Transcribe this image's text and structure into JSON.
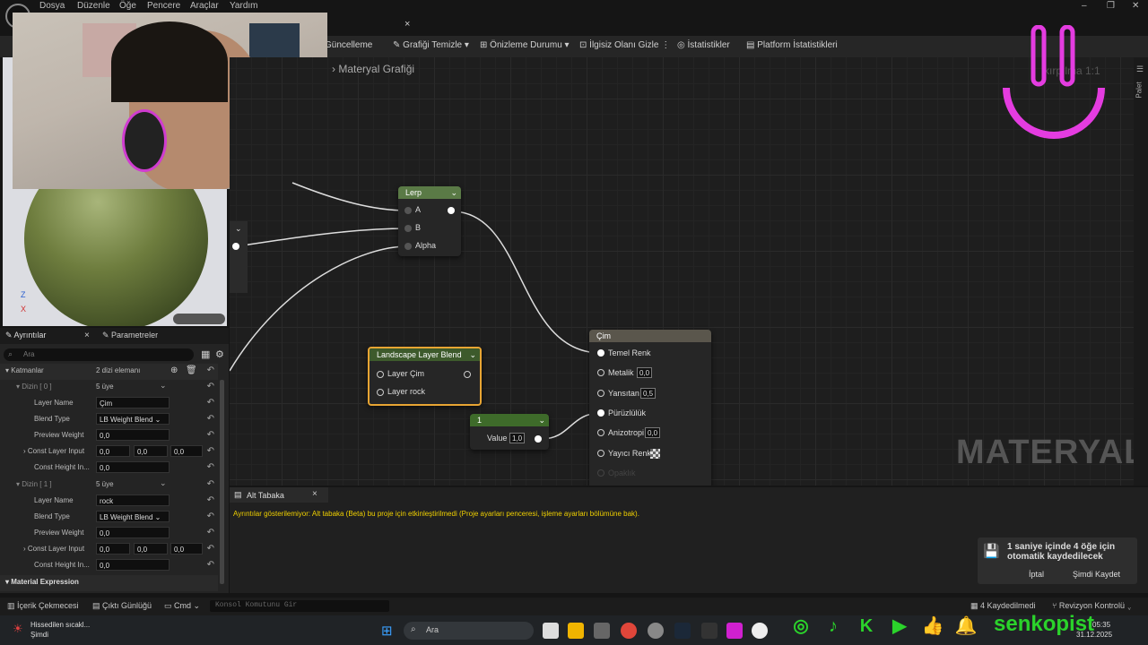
{
  "menu": {
    "items": [
      "Dosya",
      "Düzenle",
      "Öğe",
      "Pencere",
      "Araçlar",
      "Yardım"
    ]
  },
  "window_controls": {
    "minimize": "–",
    "maximize": "❐",
    "close": "✕"
  },
  "toolbar": {
    "update_label": "Güncelleme",
    "clean_graph_label": "Grafiği Temizle",
    "preview_state_label": "Önizleme Durumu",
    "hide_unrelated_label": "İlgisiz Olanı Gizle",
    "stats_label": "İstatistikler",
    "platform_stats_label": "Platform İstatistikleri",
    "tab_close": "×"
  },
  "graph": {
    "breadcrumb_label": "Materyal Grafiği",
    "breadcrumb_chevron": "›",
    "side_tab_label": "Palet",
    "partial_text": "kırpılma 1:1",
    "watermark": "MATERYAL",
    "nodes": {
      "lerp": {
        "title": "Lerp",
        "pins": [
          "A",
          "B",
          "Alpha"
        ]
      },
      "landscape": {
        "title": "Landscape Layer Blend",
        "pins": [
          "Layer Çim",
          "Layer rock"
        ]
      },
      "constant": {
        "title": "1",
        "value_label": "Value",
        "value": "1,0"
      },
      "material": {
        "title": "Çim",
        "pins": [
          {
            "label": "Temel Renk",
            "value": ""
          },
          {
            "label": "Metalik",
            "value": "0,0"
          },
          {
            "label": "Yansıtan",
            "value": "0,5"
          },
          {
            "label": "Pürüzlülük",
            "value": ""
          },
          {
            "label": "Anizotropi",
            "value": "0,0"
          },
          {
            "label": "Yayıcı Renk",
            "value": ""
          },
          {
            "label": "Opaklık",
            "value": ""
          }
        ]
      }
    }
  },
  "details_panel": {
    "tab_details": "Ayrıntılar",
    "tab_params": "Parametreler",
    "close": "×",
    "search_placeholder": "Ara",
    "layers_label": "Katmanlar",
    "layers_count": "2 dizi elemanı",
    "groups": [
      {
        "index_label": "Dizin [ 0 ]",
        "count": "5 üye",
        "layer_name": "Çim",
        "blend_type": "LB Weight Blend",
        "preview_weight": "0,0",
        "const_layer_input": [
          "0,0",
          "0,0",
          "0,0"
        ],
        "const_height_input": "0,0"
      },
      {
        "index_label": "Dizin [ 1 ]",
        "count": "5 üye",
        "layer_name": "rock",
        "blend_type": "LB Weight Blend",
        "preview_weight": "0,0",
        "const_layer_input": [
          "0,0",
          "0,0",
          "0,0"
        ],
        "const_height_input": "0,0"
      }
    ],
    "field_labels": {
      "layer_name": "Layer Name",
      "blend_type": "Blend Type",
      "preview_weight": "Preview Weight",
      "const_layer_input": "Const Layer Input",
      "const_height_input": "Const Height In..."
    },
    "material_expression": "Material Expression"
  },
  "sub_panel": {
    "tab": "Alt Tabaka",
    "close": "×",
    "message": "Ayrıntılar gösterilemiyor: Alt tabaka (Beta) bu proje için etkinleştirilmedi (Proje ayarları penceresi, işleme ayarları bölümüne bak)."
  },
  "autosave": {
    "message": "1 saniye içinde 4 öğe için otomatik kaydedilecek",
    "cancel": "İptal",
    "save_now": "Şimdi Kaydet"
  },
  "statusbar": {
    "content_drawer": "İçerik Çekmecesi",
    "output_log": "Çıktı Günlüğü",
    "cmd": "Cmd",
    "console_placeholder": "Konsol Komutunu Gir",
    "saved": "4 Kaydedilmedi",
    "revision": "Revizyon Kontrolü"
  },
  "taskbar": {
    "weather_title": "Hissedilen sıcakl...",
    "weather_sub": "Şimdi",
    "search": "Ara",
    "time": "05:35",
    "date": "31.12.2025",
    "brand": "senkopist"
  },
  "axis_gizmo": {
    "z": "Z",
    "x": "X"
  },
  "colors": {
    "lerp_header": "#5a7a46",
    "landscape_header": "#3d5a2c",
    "constant_header": "#3e6b2a",
    "material_header": "#5a564c",
    "landscape_border": "#e8a533",
    "brand_green": "#2bd32b",
    "smile_pink": "#e43ce0"
  }
}
